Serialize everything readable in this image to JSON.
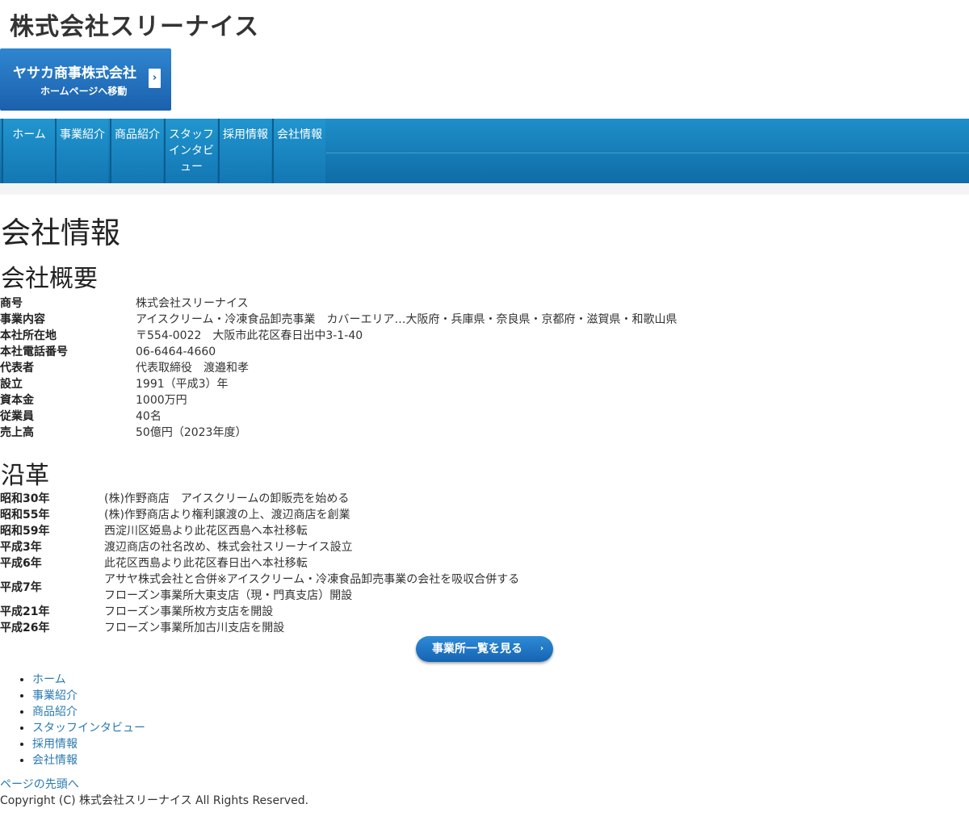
{
  "header": {
    "site_title": "株式会社スリーナイス",
    "banner": {
      "line1": "ヤサカ商事株式会社",
      "line2": "ホームページへ移動",
      "arrow": "›"
    }
  },
  "gnav": {
    "items": [
      {
        "label": "ホーム"
      },
      {
        "label": "事業紹介"
      },
      {
        "label": "商品紹介"
      },
      {
        "label": "スタッフインタビュー"
      },
      {
        "label": "採用情報"
      },
      {
        "label": "会社情報"
      }
    ]
  },
  "main": {
    "page_title": "会社情報",
    "overview_title": "会社概要",
    "overview": [
      {
        "key": "商号",
        "value": "株式会社スリーナイス"
      },
      {
        "key": "事業内容",
        "value": "アイスクリーム・冷凍食品卸売事業　カバーエリア…大阪府・兵庫県・奈良県・京都府・滋賀県・和歌山県"
      },
      {
        "key": "本社所在地",
        "value": "〒554-0022　大阪市此花区春日出中3-1-40"
      },
      {
        "key": "本社電話番号",
        "value": "06-6464-4660"
      },
      {
        "key": "代表者",
        "value": "代表取締役　渡邉和孝"
      },
      {
        "key": "設立",
        "value": "1991（平成3）年"
      },
      {
        "key": "資本金",
        "value": "1000万円"
      },
      {
        "key": "従業員",
        "value": "40名"
      },
      {
        "key": "売上高",
        "value": "50億円（2023年度）"
      }
    ],
    "history_title": "沿革",
    "history": [
      {
        "year": "昭和30年",
        "events": [
          "(株)作野商店　アイスクリームの卸販売を始める"
        ]
      },
      {
        "year": "昭和55年",
        "events": [
          "(株)作野商店より権利譲渡の上、渡辺商店を創業"
        ]
      },
      {
        "year": "昭和59年",
        "events": [
          "西淀川区姫島より此花区西島へ本社移転"
        ]
      },
      {
        "year": "平成3年",
        "events": [
          "渡辺商店の社名改め、株式会社スリーナイス設立"
        ]
      },
      {
        "year": "平成6年",
        "events": [
          "此花区西島より此花区春日出へ本社移転"
        ]
      },
      {
        "year": "平成7年",
        "events": [
          "アサヤ株式会社と合併※アイスクリーム・冷凍食品卸売事業の会社を吸収合併する",
          "フローズン事業所大東支店（現・門真支店）開設"
        ]
      },
      {
        "year": "平成21年",
        "events": [
          "フローズン事業所枚方支店を開設"
        ]
      },
      {
        "year": "平成26年",
        "events": [
          "フローズン事業所加古川支店を開設"
        ]
      }
    ],
    "cta_label": "事業所一覧を見る",
    "cta_arrow": "›"
  },
  "footer": {
    "nav": [
      {
        "label": "ホーム"
      },
      {
        "label": "事業紹介"
      },
      {
        "label": "商品紹介"
      },
      {
        "label": "スタッフインタビュー"
      },
      {
        "label": "採用情報"
      },
      {
        "label": "会社情報"
      }
    ],
    "back_to_top": "ページの先頭へ",
    "copyright": "Copyright (C) 株式会社スリーナイス All Rights Reserved."
  },
  "colors": {
    "nav_blue": "#1e8fc9",
    "banner_blue": "#1b60ad",
    "link": "#2a7ab0"
  }
}
